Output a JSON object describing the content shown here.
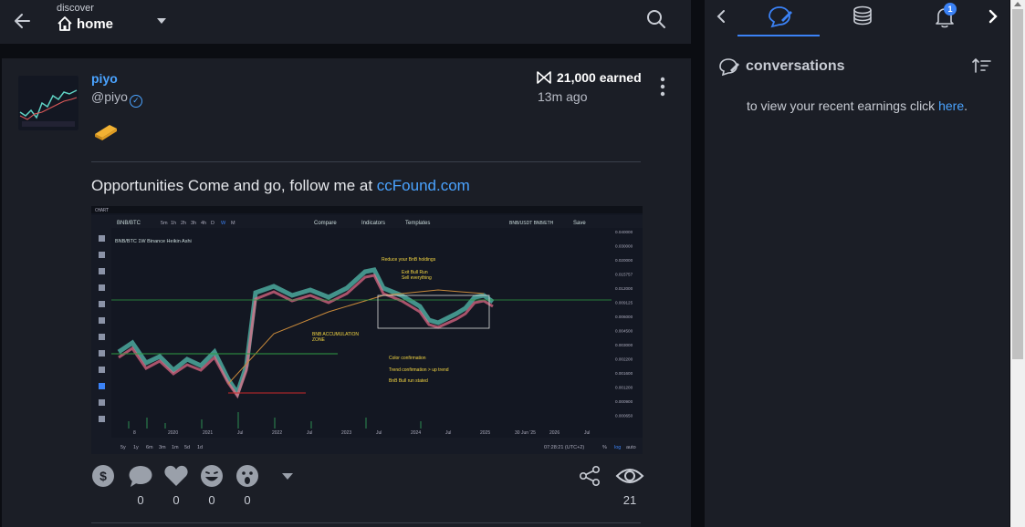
{
  "header": {
    "section_label": "discover",
    "location_label": "home"
  },
  "post": {
    "author_name": "piyo",
    "author_handle": "@piyo",
    "earned": "21,000 earned",
    "time_ago": "13m ago",
    "text_prefix": "Opportunities Come and go, follow me at ",
    "link_text": "ccFound.com",
    "actions": {
      "comments": "0",
      "likes": "0",
      "laughs": "0",
      "wows": "0",
      "views": "21"
    },
    "chart": {
      "header": "CHART",
      "symbol": "BNB/BTC",
      "timeframes": [
        "5m",
        "1h",
        "2h",
        "3h",
        "4h",
        "D",
        "W",
        "M"
      ],
      "toolbar_compare": "Compare",
      "toolbar_indicators": "Indicators",
      "toolbar_templates": "Templates",
      "toolbar_pairs": "BNB/USDT  BNB/ETH",
      "toolbar_save": "Save",
      "legend_line": "BNB/BTC  1W  Binance  Heikin Ashi",
      "annotations": [
        "Reduce your BnB holdings",
        "Exit Bull Run\nSell everything",
        "BNB ACCUMULATION\nZONE",
        "Color confirmation",
        "Trend confirmation > up trend",
        "BnB Bull run stated"
      ],
      "x_labels": [
        "8",
        "2020",
        "2021",
        "Jul",
        "2022",
        "Jul",
        "2023",
        "Jul",
        "2024",
        "Jul",
        "2025",
        "30 Jun '25",
        "2026",
        "Jul"
      ],
      "y_labels": [
        "0.040000",
        "0.030000",
        "0.020000",
        "0.015757",
        "0.012000",
        "0.009125",
        "0.006000",
        "0.004500",
        "0.003000",
        "0.002200",
        "0.001600",
        "0.001200",
        "0.000900",
        "0.000650"
      ],
      "bottom_ranges": [
        "5y",
        "1y",
        "6m",
        "3m",
        "1m",
        "5d",
        "1d"
      ],
      "bottom_time": "07:28:21 (UTC+2)",
      "bottom_right": [
        "%",
        "log",
        "auto"
      ]
    }
  },
  "right_panel": {
    "conversations_title": "conversations",
    "notif_count": "1",
    "earnings_text": "to view your recent earnings click ",
    "earnings_link": "here",
    "earnings_suffix": "."
  },
  "colors": {
    "accent": "#3b82f6",
    "link": "#4aa3ff",
    "panel_bg": "#1b1e26",
    "page_bg": "#0b0d12"
  }
}
